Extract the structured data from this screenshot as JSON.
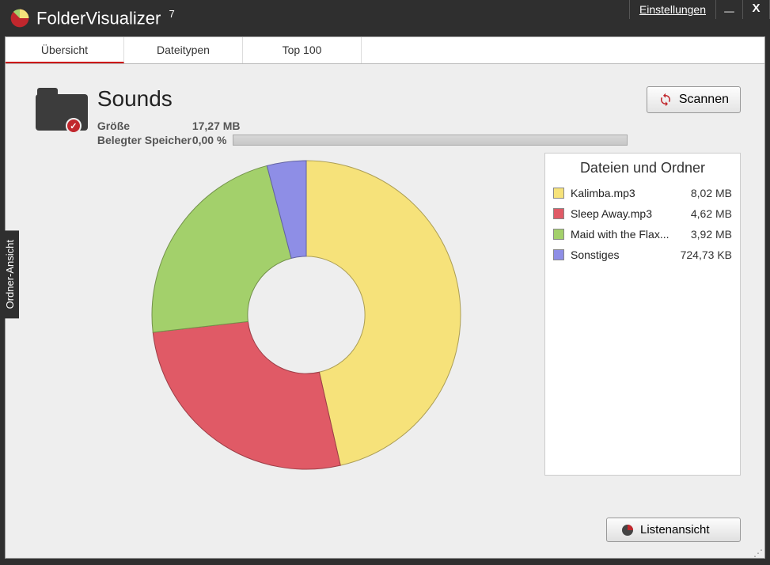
{
  "app": {
    "name": "FolderVisualizer",
    "version": "7",
    "settings_label": "Einstellungen"
  },
  "tabs": {
    "overview": "Übersicht",
    "filetypes": "Dateitypen",
    "top100": "Top 100"
  },
  "side_tab": "Ordner-Ansicht",
  "folder": {
    "name": "Sounds",
    "size_label": "Größe",
    "size_value": "17,27 MB",
    "used_label": "Belegter Speicher",
    "used_value": "0,00 %"
  },
  "buttons": {
    "scan": "Scannen",
    "list_view": "Listenansicht"
  },
  "legend": {
    "title": "Dateien und Ordner",
    "items": [
      {
        "color": "#f6e27a",
        "name": "Kalimba.mp3",
        "size": "8,02 MB"
      },
      {
        "color": "#e05a66",
        "name": "Sleep Away.mp3",
        "size": "4,62 MB"
      },
      {
        "color": "#a3d06b",
        "name": "Maid with the Flax...",
        "size": "3,92 MB"
      },
      {
        "color": "#8e8ee6",
        "name": "Sonstiges",
        "size": "724,73 KB"
      }
    ]
  },
  "chart_data": {
    "type": "pie",
    "title": "Dateien und Ordner",
    "series": [
      {
        "name": "Kalimba.mp3",
        "value": 8.02,
        "unit": "MB",
        "color": "#f6e27a"
      },
      {
        "name": "Sleep Away.mp3",
        "value": 4.62,
        "unit": "MB",
        "color": "#e05a66"
      },
      {
        "name": "Maid with the Flax...",
        "value": 3.92,
        "unit": "MB",
        "color": "#a3d06b"
      },
      {
        "name": "Sonstiges",
        "value": 0.708,
        "unit": "MB",
        "color": "#8e8ee6"
      }
    ],
    "inner_radius_ratio": 0.38,
    "start_angle_deg": 0
  }
}
